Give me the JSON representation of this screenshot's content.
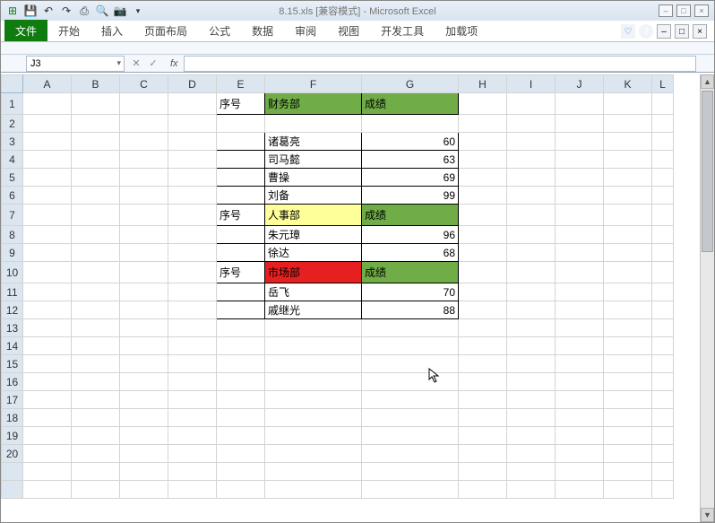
{
  "title": "8.15.xls  [兼容模式]  -  Microsoft Excel",
  "namebox": "J3",
  "fx_label": "fx",
  "ribbon": {
    "file": "文件",
    "tabs": [
      "开始",
      "插入",
      "页面布局",
      "公式",
      "数据",
      "审阅",
      "视图",
      "开发工具",
      "加载项"
    ]
  },
  "columns": [
    "A",
    "B",
    "C",
    "D",
    "E",
    "F",
    "G",
    "H",
    "I",
    "J",
    "K",
    "L"
  ],
  "rows": {
    "r1": {
      "E": "序号",
      "F": "财务部",
      "G": "成绩"
    },
    "r3": {
      "F": "诸葛亮",
      "G": "60"
    },
    "r4": {
      "F": "司马懿",
      "G": "63"
    },
    "r5": {
      "F": "曹操",
      "G": "69"
    },
    "r6": {
      "F": "刘备",
      "G": "99"
    },
    "r7": {
      "E": "序号",
      "F": "人事部",
      "G": "成绩"
    },
    "r8": {
      "F": "朱元璋",
      "G": "96"
    },
    "r9": {
      "F": "徐达",
      "G": "68"
    },
    "r10": {
      "E": "序号",
      "F": "市场部",
      "G": "成绩"
    },
    "r11": {
      "F": "岳飞",
      "G": "70"
    },
    "r12": {
      "F": "戚继光",
      "G": "88"
    }
  }
}
